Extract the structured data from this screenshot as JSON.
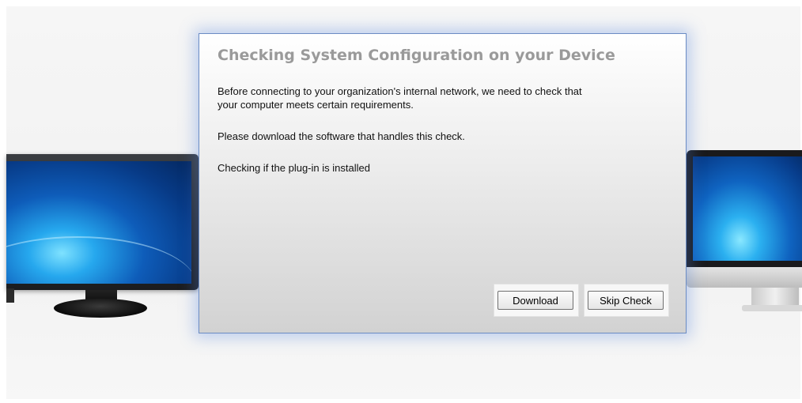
{
  "dialog": {
    "title": "Checking System Configuration on your Device",
    "paragraph1_line1": "Before connecting to your organization's internal network, we need to check that",
    "paragraph1_line2": "your computer meets certain requirements.",
    "paragraph2": "Please download the software that handles this check.",
    "status": "Checking if the plug-in is installed"
  },
  "buttons": {
    "download_label": "Download",
    "skip_label": "Skip Check"
  },
  "colors": {
    "title": "#9a9a9a",
    "dialog_border": "#6b8cc4",
    "dialog_glow": "#5082dc"
  },
  "decorations": {
    "left_image": "desktop-monitor",
    "right_image": "imac-monitor"
  }
}
